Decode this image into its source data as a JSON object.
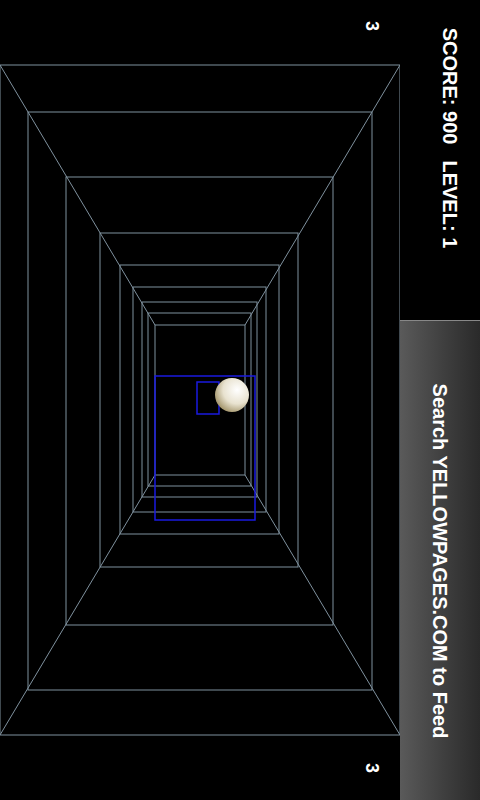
{
  "hud": {
    "score": "SCORE: 900",
    "level": "LEVEL: 1",
    "corner_counts": [
      "3",
      "3"
    ]
  },
  "ad_banner": {
    "text": "Search YELLOWPAGES.COM to Feed"
  }
}
